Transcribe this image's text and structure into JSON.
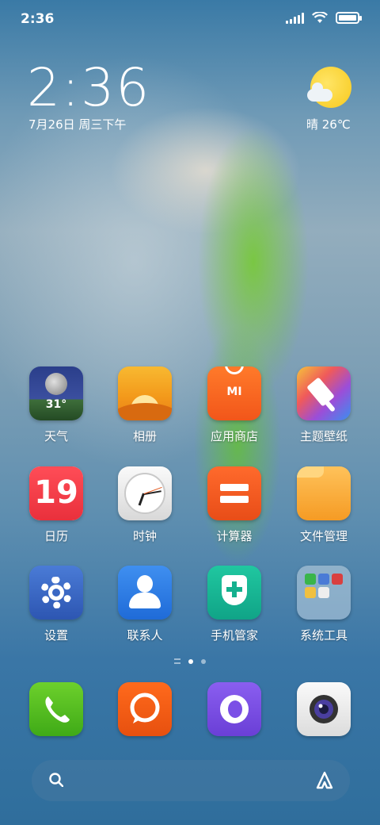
{
  "status_bar": {
    "time": "2:36"
  },
  "widget": {
    "clock": "2:36",
    "date": "7月26日 周三下午",
    "weather": "晴 26℃"
  },
  "apps": {
    "weather": {
      "label": "天气",
      "temp": "31°"
    },
    "gallery": {
      "label": "相册"
    },
    "app_store": {
      "label": "应用商店",
      "logo": "MI"
    },
    "themes": {
      "label": "主题壁纸"
    },
    "calendar": {
      "label": "日历",
      "day": "19"
    },
    "clock": {
      "label": "时钟"
    },
    "calculator": {
      "label": "计算器"
    },
    "file_manager": {
      "label": "文件管理"
    },
    "settings": {
      "label": "设置"
    },
    "contacts": {
      "label": "联系人"
    },
    "security": {
      "label": "手机管家"
    },
    "system_tools": {
      "label": "系统工具"
    }
  },
  "dock": {
    "items": [
      {
        "icon": "phone-icon"
      },
      {
        "icon": "messages-icon"
      },
      {
        "icon": "browser-icon"
      },
      {
        "icon": "camera-icon"
      }
    ]
  },
  "pages": {
    "count": 2,
    "current": 1
  }
}
